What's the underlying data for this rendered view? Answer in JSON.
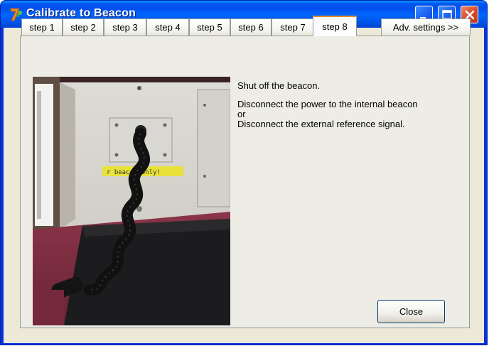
{
  "window": {
    "title": "Calibrate to Beacon"
  },
  "titlebar_buttons": {
    "minimize": "minimize-icon",
    "maximize": "maximize-icon",
    "close": "close-icon"
  },
  "tabs": [
    {
      "label": "step 1",
      "active": false
    },
    {
      "label": "step 2",
      "active": false
    },
    {
      "label": "step 3",
      "active": false
    },
    {
      "label": "step 4",
      "active": false
    },
    {
      "label": "step 5",
      "active": false
    },
    {
      "label": "step 6",
      "active": false
    },
    {
      "label": "step 7",
      "active": false
    },
    {
      "label": "step 8",
      "active": true
    }
  ],
  "adv_settings_label": "Adv. settings >>",
  "photo": {
    "sticker_text": "r beacon only!"
  },
  "instructions": {
    "line1": "Shut off the beacon.",
    "line2": "Disconnect the power to the internal beacon",
    "line3": "or",
    "line4": "Disconnect the external reference signal."
  },
  "close_label": "Close",
  "colors": {
    "titlebar": "#0055ea",
    "client_bg": "#ece9d8",
    "active_tab_accent": "#e68b2c"
  }
}
